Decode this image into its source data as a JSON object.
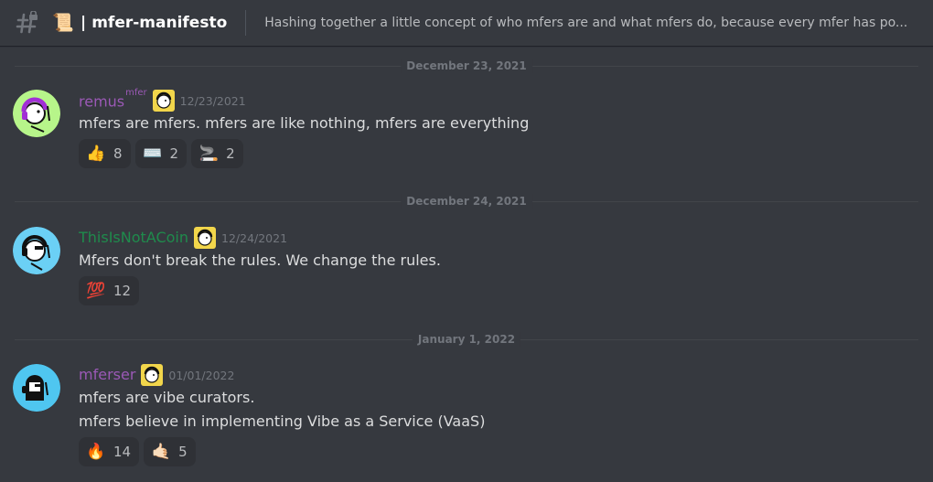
{
  "header": {
    "channel_icon": "text-channel-lock-icon",
    "scroll_emoji": "📜",
    "separator": "|",
    "channel_name": "mfer-manifesto",
    "topic": "Hashing together a little concept of who mfers are and what mfers do, because every mfer has po..."
  },
  "dividers": [
    {
      "label": "December 23, 2021"
    },
    {
      "label": "December 24, 2021"
    },
    {
      "label": "January 1, 2022"
    }
  ],
  "messages": [
    {
      "username": "remus",
      "tag": "mfer",
      "username_color": "#9b59b6",
      "timestamp": "12/23/2021",
      "lines": [
        "mfers are mfers. mfers are like nothing, mfers are everything"
      ],
      "reactions": [
        {
          "emoji": "👍",
          "icon": "thumbs-up-icon",
          "count": "8"
        },
        {
          "emoji": "⌨️",
          "icon": "keyboard-icon",
          "count": "2"
        },
        {
          "emoji": "🚬",
          "icon": "cigarette-icon",
          "count": "2"
        }
      ],
      "avatar_bg": "#b7f58a"
    },
    {
      "username": "ThisIsNotACoin",
      "username_color": "#1f8b4c",
      "timestamp": "12/24/2021",
      "lines": [
        "Mfers don't break the rules. We change the rules."
      ],
      "reactions": [
        {
          "emoji": "💯",
          "icon": "hundred-points-icon",
          "count": "12"
        }
      ],
      "avatar_bg": "#6bd0f5"
    },
    {
      "username": "mferser",
      "username_color": "#9b59b6",
      "timestamp": "01/01/2022",
      "lines": [
        "mfers are vibe curators.",
        "mfers believe in implementing Vibe as a Service (VaaS)"
      ],
      "reactions": [
        {
          "emoji": "🔥",
          "icon": "fire-icon",
          "count": "14"
        },
        {
          "emoji": "🤙🏻",
          "icon": "call-me-hand-icon",
          "count": "5"
        }
      ],
      "avatar_bg": "#4fc6f0"
    }
  ]
}
